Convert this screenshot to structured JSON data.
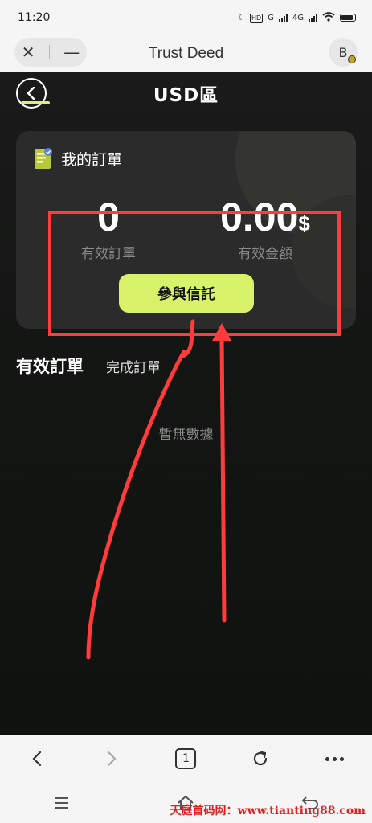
{
  "status_bar": {
    "time": "11:20",
    "network": "4G",
    "hd": "HD",
    "g": "G"
  },
  "browser": {
    "title": "Trust Deed",
    "avatar_letter": "B",
    "tab_count": "1"
  },
  "app": {
    "page_title": "USD區",
    "card": {
      "title": "我的訂單",
      "valid_orders_value": "0",
      "valid_orders_label": "有效訂單",
      "valid_amount_value": "0.00",
      "valid_amount_unit": "$",
      "valid_amount_label": "有效金額",
      "join_button": "參與信託"
    },
    "tabs": [
      {
        "label": "有效訂單",
        "active": true
      },
      {
        "label": "完成訂單",
        "active": false
      }
    ],
    "empty_text": "暫無數據"
  },
  "watermark": "天庭首码网：www.tianting88.com",
  "colors": {
    "accent": "#d8f36a",
    "annotation": "#ff3b3b",
    "app_bg": "#141614"
  }
}
